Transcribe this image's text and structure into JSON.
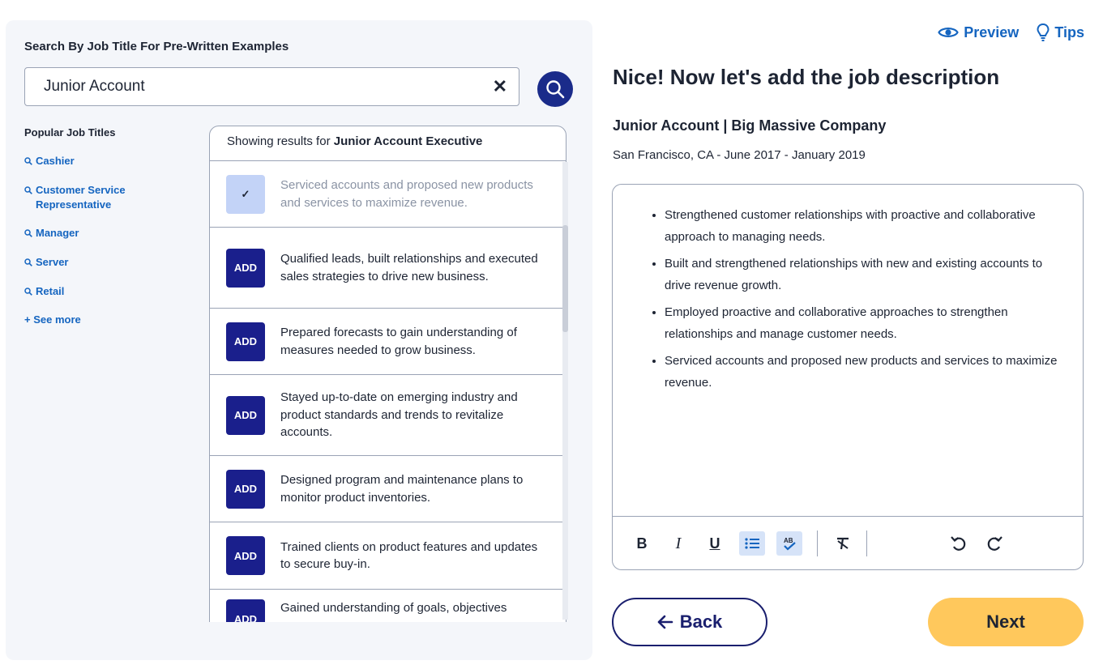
{
  "left": {
    "search_heading": "Search By Job Title For Pre-Written Examples",
    "search_value": "Junior Account",
    "clear_glyph": "✕",
    "popular_title": "Popular Job Titles",
    "popular": [
      "Cashier",
      "Customer Service Representative",
      "Manager",
      "Server",
      "Retail"
    ],
    "see_more": "+ See more",
    "results_prefix": "Showing results for ",
    "results_query": "Junior Account Executive",
    "results": [
      {
        "button": "✓",
        "text": "Serviced accounts and proposed new products and services to maximize revenue.",
        "added": true
      },
      {
        "button": "ADD",
        "text": "Qualified leads, built relationships and executed sales strategies to drive new business.",
        "added": false
      },
      {
        "button": "ADD",
        "text": "Prepared forecasts to gain understanding of measures needed to grow business.",
        "added": false
      },
      {
        "button": "ADD",
        "text": "Stayed up-to-date on emerging industry and product standards and trends to revitalize accounts.",
        "added": false
      },
      {
        "button": "ADD",
        "text": "Designed program and maintenance plans to monitor product inventories.",
        "added": false
      },
      {
        "button": "ADD",
        "text": "Trained clients on product features and updates to secure buy-in.",
        "added": false
      },
      {
        "button": "ADD",
        "text": "Gained understanding of goals, objectives",
        "added": false
      }
    ]
  },
  "header": {
    "preview": "Preview",
    "tips": "Tips"
  },
  "main": {
    "title": "Nice! Now let's add the job description",
    "job_line": "Junior Account | Big Massive Company",
    "job_sub": "San Francisco, CA - June 2017 - January 2019",
    "bullets": [
      "Strengthened customer relationships with proactive and collaborative approach to managing needs.",
      "Built and strengthened relationships with new and existing accounts to drive revenue growth.",
      "Employed proactive and collaborative approaches to strengthen relationships and manage customer needs.",
      "Serviced accounts and proposed new products and services to maximize revenue."
    ],
    "toolbar": {
      "bold": "B",
      "italic": "I",
      "underline": "U"
    }
  },
  "footer": {
    "back": "Back",
    "next": "Next"
  },
  "colors": {
    "accent": "#1565c0",
    "navy": "#1a1f8c",
    "next": "#ffc85c"
  }
}
